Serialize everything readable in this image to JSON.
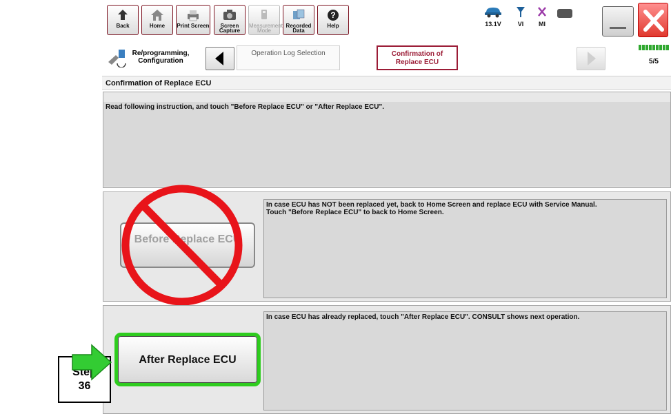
{
  "toolbar": {
    "back_label": "Back",
    "home_label": "Home",
    "print_screen_label": "Print Screen",
    "screen_capture_label": "Screen Capture",
    "measurement_mode_label": "Measurement Mode",
    "recorded_data_label": "Recorded Data",
    "help_label": "Help",
    "battery_voltage": "13.1V",
    "vi_label": "VI",
    "mi_label": "MI"
  },
  "breadcrumb": {
    "step1_label": "Re/programming, Configuration",
    "step2_label": "Operation Log Selection",
    "step3_label": "Confirmation of Replace ECU",
    "page_counter": "5/5"
  },
  "page": {
    "title": "Confirmation of Replace ECU",
    "instruction": "Read following instruction, and touch \"Before Replace ECU\" or \"After Replace ECU\"."
  },
  "before_section": {
    "button_label": "Before Replace ECU",
    "description": "In case ECU has NOT been replaced yet, back to Home Screen and replace ECU with Service Manual.\nTouch \"Before Replace ECU\" to back to Home Screen."
  },
  "after_section": {
    "button_label": "After Replace ECU",
    "description": "In case ECU has already replaced, touch \"After Replace ECU\". CONSULT shows next operation."
  },
  "annotation": {
    "step_label": "Step\n36"
  },
  "colors": {
    "highlight_green": "#2ecc1e",
    "prohibited_red": "#e8141a",
    "active_crumb_border": "#9b1c36"
  }
}
